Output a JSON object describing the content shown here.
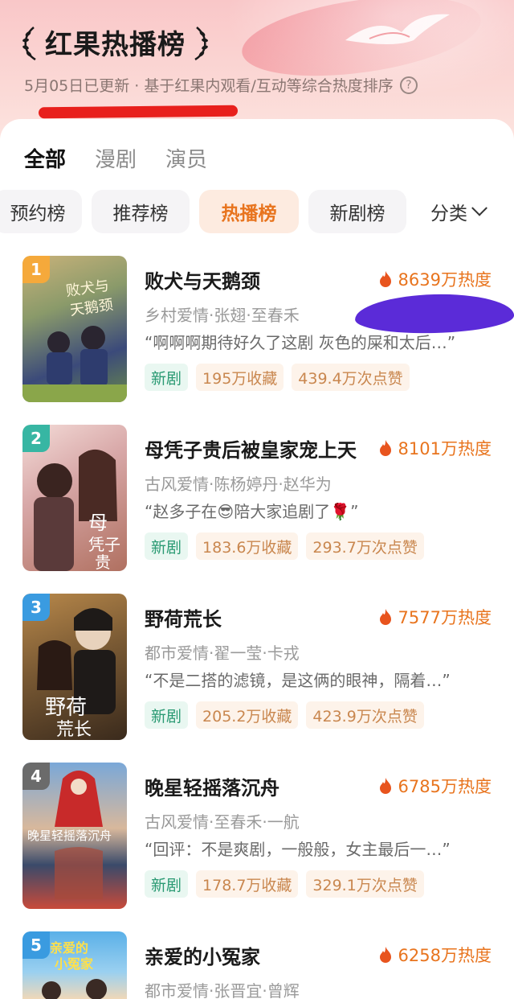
{
  "header": {
    "title": "红果热播榜",
    "subtitle": "5月05日已更新 · 基于红果内观看/互动等综合热度排序",
    "help_icon": "?"
  },
  "tabs": [
    {
      "label": "全部",
      "active": true
    },
    {
      "label": "漫剧",
      "active": false
    },
    {
      "label": "演员",
      "active": false
    }
  ],
  "chips": [
    {
      "label": "预约榜",
      "active": false
    },
    {
      "label": "推荐榜",
      "active": false
    },
    {
      "label": "热播榜",
      "active": true
    },
    {
      "label": "新剧榜",
      "active": false
    }
  ],
  "sort": {
    "label": "分类"
  },
  "colors": {
    "accent": "#e8741e",
    "rank1": "#f5a93b",
    "rank2": "#37b6a3",
    "rank3": "#3a9be0",
    "rank4": "#6b6b6b",
    "rank5": "#3a9be0"
  },
  "items": [
    {
      "rank": "1",
      "name": "败犬与天鹅颈",
      "heat": "8639万热度",
      "tags": "乡村爱情·张翅·至春禾",
      "quote": "“啊啊啊期待好久了这剧 灰色的屎和太后…”",
      "badge_new": "新剧",
      "favorites": "195万收藏",
      "likes": "439.4万次点赞",
      "poster_text": "败犬与天鹅颈"
    },
    {
      "rank": "2",
      "name": "母凭子贵后被皇家宠上天",
      "heat": "8101万热度",
      "tags": "古风爱情·陈杨婷丹·赵华为",
      "quote": "“赵多子在😎陪大家追剧了🌹”",
      "badge_new": "新剧",
      "favorites": "183.6万收藏",
      "likes": "293.7万次点赞",
      "poster_text": "母凭子贵"
    },
    {
      "rank": "3",
      "name": "野荷荒长",
      "heat": "7577万热度",
      "tags": "都市爱情·翟一莹·卡戎",
      "quote": "“不是二搭的滤镜，是这俩的眼神，隔着…”",
      "badge_new": "新剧",
      "favorites": "205.2万收藏",
      "likes": "423.9万次点赞",
      "poster_text": "野荷荒长"
    },
    {
      "rank": "4",
      "name": "晚星轻摇落沉舟",
      "heat": "6785万热度",
      "tags": "古风爱情·至春禾·一航",
      "quote": "“回评：不是爽剧，一般般，女主最后一…”",
      "badge_new": "新剧",
      "favorites": "178.7万收藏",
      "likes": "329.1万次点赞",
      "poster_text": "晚星轻摇落沉舟"
    },
    {
      "rank": "5",
      "name": "亲爱的小冤家",
      "heat": "6258万热度",
      "tags": "都市爱情·张晋宜·曾辉",
      "quote": "",
      "badge_new": "",
      "favorites": "",
      "likes": "",
      "poster_text": "亲爱的小冤家"
    }
  ]
}
